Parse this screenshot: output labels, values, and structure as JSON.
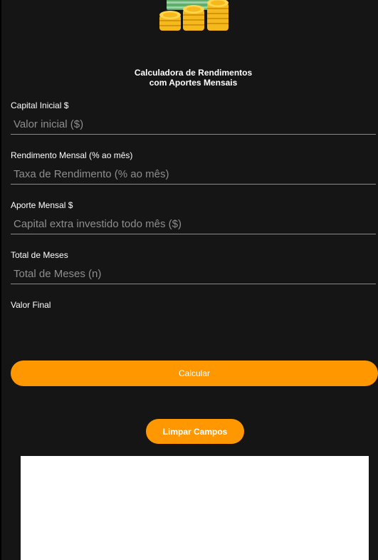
{
  "app": {
    "title_line1": "Calculadora de Rendimentos",
    "title_line2": "com Aportes Mensais",
    "logo_icon": "coins-and-money-icon"
  },
  "fields": {
    "capital": {
      "label": "Capital Inicial $",
      "placeholder": "Valor inicial ($)",
      "value": ""
    },
    "rendimento": {
      "label": "Rendimento Mensal (% ao mês)",
      "placeholder": "Taxa de Rendimento (% ao mês)",
      "value": ""
    },
    "aporte": {
      "label": "Aporte Mensal $",
      "placeholder": "Capital extra investido todo mês ($)",
      "value": ""
    },
    "meses": {
      "label": "Total de Meses",
      "placeholder": "Total de Meses (n)",
      "value": ""
    }
  },
  "result": {
    "label": "Valor Final",
    "value": ""
  },
  "buttons": {
    "calcular": "Calcular",
    "limpar": "Limpar Campos"
  },
  "colors": {
    "background": "#151515",
    "accent": "#ff9800",
    "text": "#ffffff",
    "placeholder": "#8e8e8e",
    "underline": "#8a8a8a",
    "coin": "#f5b91e",
    "money": "#5fae6e"
  }
}
